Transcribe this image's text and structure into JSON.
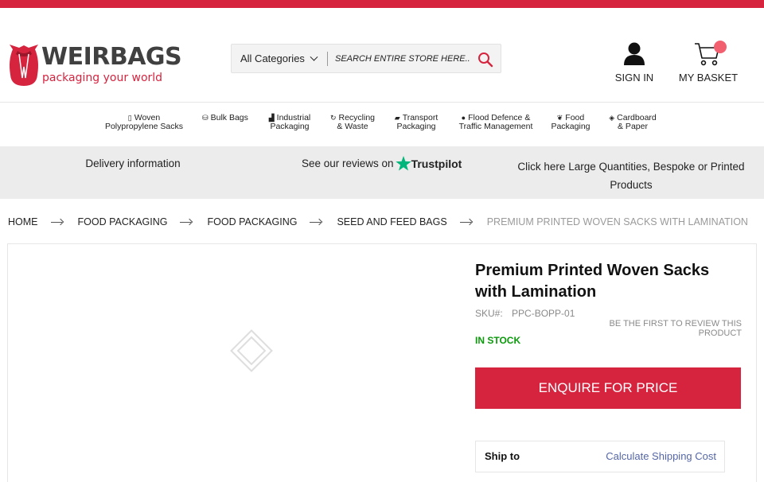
{
  "brand": {
    "name": "WEIRBAGS",
    "tagline": "packaging your world",
    "accent_color": "#d6243f",
    "logo_icon": "sack-icon"
  },
  "search": {
    "category_label": "All Categories",
    "placeholder": "Search entire store here...",
    "button_icon": "search-icon"
  },
  "account": {
    "sign_in_label": "SIGN IN",
    "basket_label": "MY BASKET",
    "sign_in_icon": "user-icon",
    "basket_icon": "cart-icon"
  },
  "nav": {
    "items": [
      {
        "line1": "Woven",
        "line2": "Polypropylene Sacks",
        "icon": "sack-small-icon"
      },
      {
        "line1": "Bulk Bags",
        "line2": "",
        "icon": "bags-icon"
      },
      {
        "line1": "Industrial",
        "line2": "Packaging",
        "icon": "factory-icon"
      },
      {
        "line1": "Recycling",
        "line2": "& Waste",
        "icon": "recycle-icon"
      },
      {
        "line1": "Transport",
        "line2": "Packaging",
        "icon": "truck-icon"
      },
      {
        "line1": "Flood Defence &",
        "line2": "Traffic Management",
        "icon": "water-drop-icon"
      },
      {
        "line1": "Food",
        "line2": "Packaging",
        "icon": "leaf-icon"
      },
      {
        "line1": "Cardboard",
        "line2": "& Paper",
        "icon": "box-icon"
      }
    ]
  },
  "infobar": {
    "delivery": "Delivery information",
    "reviews_prefix": "See our reviews on",
    "trustpilot": "Trustpilot",
    "trustpilot_color": "#00b67a",
    "custom": "Click here Large Quantities, Bespoke or Printed Products"
  },
  "breadcrumb": {
    "items": [
      "HOME",
      "FOOD PACKAGING",
      "FOOD PACKAGING",
      "SEED AND FEED BAGS"
    ],
    "current": "PREMIUM PRINTED WOVEN SACKS WITH LAMINATION"
  },
  "product": {
    "title": "Premium Printed Woven Sacks with Lamination",
    "sku_label": "SKU#:",
    "sku": "PPC-BOPP-01",
    "review_prompt": "BE THE FIRST TO REVIEW THIS PRODUCT",
    "stock": "IN STOCK",
    "stock_color": "#0b9a0b",
    "enquire_label": "ENQUIRE FOR PRICE",
    "ship_to_label": "Ship to",
    "shipping_link": "Calculate Shipping Cost",
    "image_icon": "image-placeholder-icon"
  }
}
